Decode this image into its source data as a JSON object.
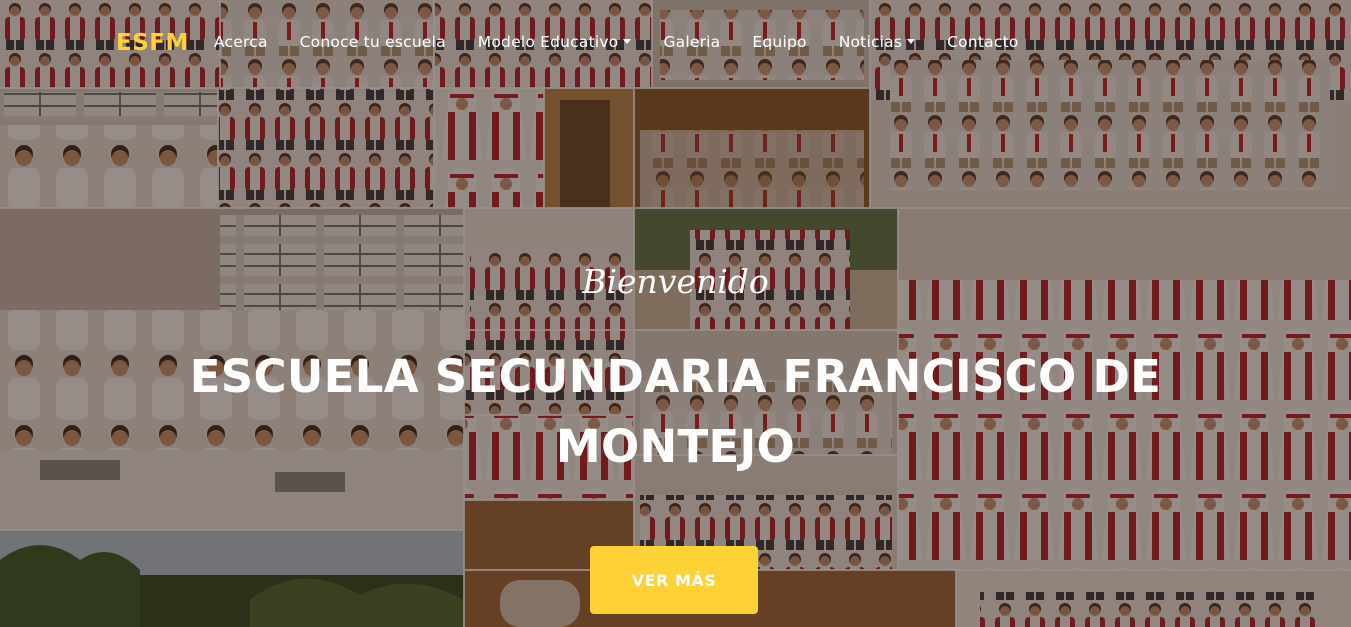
{
  "navbar": {
    "brand": "ESFM",
    "links": [
      {
        "label": "Acerca",
        "dropdown": false
      },
      {
        "label": "Conoce tu escuela",
        "dropdown": false
      },
      {
        "label": "Modelo Educativo",
        "dropdown": true
      },
      {
        "label": "Galeria",
        "dropdown": false
      },
      {
        "label": "Equipo",
        "dropdown": false
      },
      {
        "label": "Noticias",
        "dropdown": true
      },
      {
        "label": "Contacto",
        "dropdown": false
      }
    ]
  },
  "hero": {
    "lead": "Bienvenido",
    "heading_line1": "ESCUELA SECUNDARIA FRANCISCO DE",
    "heading_line2": "MONTEJO",
    "button_label": "VER MÁS"
  },
  "colors": {
    "accent": "#fed136",
    "text": "#ffffff",
    "overlay": "rgba(40,20,12,0.48)"
  },
  "icons": {
    "caret": "caret-down-icon"
  }
}
